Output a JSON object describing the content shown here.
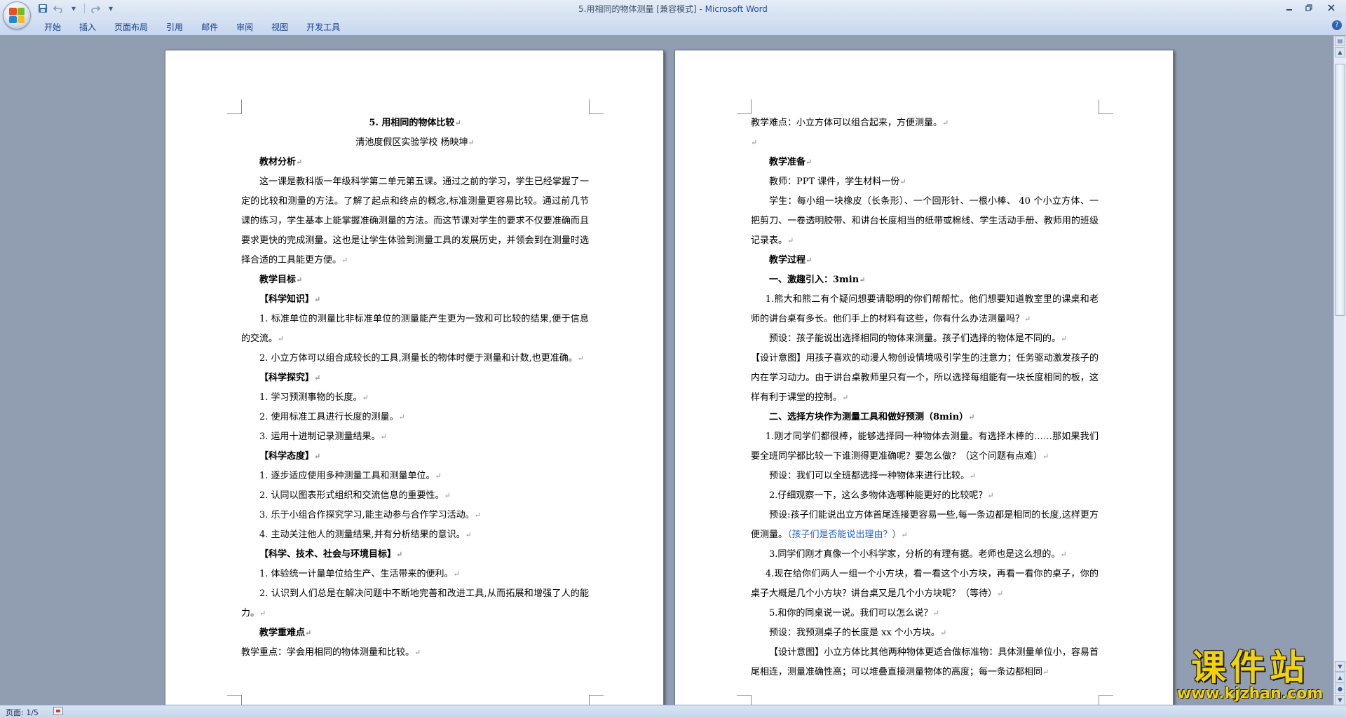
{
  "window": {
    "title": "5.用相同的物体测量 [兼容模式]",
    "app_name": "Microsoft Word",
    "title_sep": " - "
  },
  "qat": {
    "dropdown": "▾"
  },
  "ribbon": {
    "tabs": [
      "开始",
      "插入",
      "页面布局",
      "引用",
      "邮件",
      "审阅",
      "视图",
      "开发工具"
    ],
    "help": "?"
  },
  "page_left": {
    "paragraphs": [
      {
        "text": "5.  用相同的物体比较",
        "style": "center bold"
      },
      {
        "text": "清池度假区实验学校    杨映坤",
        "style": "center"
      },
      {
        "text": "教材分析",
        "style": "p-indent bold"
      },
      {
        "text": "这一课是教科版一年级科学第二单元第五课。通过之前的学习，学生已经掌握了一定的比较和测量的方法。了解了起点和终点的概念,标准测量更容易比较。通过前几节课的练习，学生基本上能掌握准确测量的方法。而这节课对学生的要求不仅要准确而且要求更快的完成测量。这也是让学生体验到测量工具的发展历史，并领会到在测量时选择合适的工具能更方便。",
        "style": "p-indent"
      },
      {
        "text": "教学目标",
        "style": "p-indent bold"
      },
      {
        "text": "【科学知识】",
        "style": "p-indent bold"
      },
      {
        "text": "1.  标准单位的测量比非标准单位的测量能产生更为一致和可比较的结果,便于信息的交流。",
        "style": "p-indent"
      },
      {
        "text": "2.  小立方体可以组合成较长的工具,测量长的物体时便于测量和计数,也更准确。",
        "style": "p-indent"
      },
      {
        "text": "【科学探究】",
        "style": "p-indent bold"
      },
      {
        "text": "1.  学习预测事物的长度。",
        "style": "p-indent"
      },
      {
        "text": "2.  使用标准工具进行长度的测量。",
        "style": "p-indent"
      },
      {
        "text": "3.  运用十进制记录测量结果。",
        "style": "p-indent"
      },
      {
        "text": "【科学态度】",
        "style": "p-indent bold"
      },
      {
        "text": "1.  逐步适应使用多种测量工具和测量单位。",
        "style": "p-indent"
      },
      {
        "text": "2.  认同以图表形式组织和交流信息的重要性。",
        "style": "p-indent"
      },
      {
        "text": "3.  乐于小组合作探究学习,能主动参与合作学习活动。",
        "style": "p-indent"
      },
      {
        "text": "4.  主动关注他人的测量结果,并有分析结果的意识。",
        "style": "p-indent"
      },
      {
        "text": "【科学、技术、社会与环境目标】",
        "style": "p-indent bold"
      },
      {
        "text": "1.  体验统一计量单位给生产、生活带来的便利。",
        "style": "p-indent"
      },
      {
        "text": "2.  认识到人们总是在解决问题中不断地完善和改进工具,从而拓展和增强了人的能力。",
        "style": "p-indent"
      },
      {
        "text": "教学重难点",
        "style": "p-indent bold"
      },
      {
        "text": "教学重点：学会用相同的物体测量和比较。",
        "style": ""
      }
    ]
  },
  "page_right": {
    "paragraphs": [
      {
        "text": "教学难点：小立方体可以组合起来，方便测量。",
        "style": ""
      },
      {
        "text": "",
        "style": ""
      },
      {
        "text": "教学准备",
        "style": "p-indent bold"
      },
      {
        "text": "教师：PPT 课件，学生材料一份",
        "style": "p-indent"
      },
      {
        "text": "学生：每小组一块橡皮（长条形）、一个回形针、一根小棒、 40 个小立方体、一把剪刀、一卷透明胶带、和讲台长度相当的纸带或棉线、学生活动手册、教师用的班级记录表。",
        "style": "p-indent"
      },
      {
        "text": "教学过程",
        "style": "p-indent bold"
      },
      {
        "text": "一、激趣引入：3min",
        "style": "p-indent bold"
      },
      {
        "text": "1.熊大和熊二有个疑问想要请聪明的你们帮帮忙。他们想要知道教室里的课桌和老师的讲台桌有多长。他们手上的材料有这些，你有什么办法测量吗？",
        "style": "p-indent1"
      },
      {
        "text": "预设：孩子能说出选择相同的物体来测量。孩子们选择的物体是不同的。",
        "style": "p-indent"
      },
      {
        "text": "【设计意图】用孩子喜欢的动漫人物创设情境吸引学生的注意力；任务驱动激发孩子的内在学习动力。由于讲台桌教师里只有一个，所以选择每组能有一块长度相同的板，这样有利于课堂的控制。",
        "style": ""
      },
      {
        "text": "二、选择方块作为测量工具和做好预测（8min）",
        "style": "p-indent bold"
      },
      {
        "text": "1.刚才同学们都很棒，能够选择同一种物体去测量。有选择木棒的……那如果我们要全班同学都比较一下谁测得更准确呢？要怎么做？（这个问题有点难）",
        "style": "p-indent1"
      },
      {
        "text": "预设：我们可以全班都选择一种物体来进行比较。",
        "style": "p-indent"
      },
      {
        "text": "2.仔细观察一下，这么多物体选哪种能更好的比较呢？",
        "style": "p-indent"
      },
      {
        "text": "预设:孩子们能说出立方体首尾连接更容易一些,每一条边都是相同的长度,这样更方便测量。",
        "style": "p-indent",
        "link": "（孩子们是否能说出理由？）"
      },
      {
        "text": "3.同学们刚才真像一个小科学家，分析的有理有据。老师也是这么想的。",
        "style": "p-indent"
      },
      {
        "text": "4.现在给你们两人一组一个小方块，看一看这个小方块，再看一看你的桌子，你的桌子大概是几个小方块？讲台桌又是几个小方块呢？（等待）",
        "style": "p-indent1"
      },
      {
        "text": "5.和你的同桌说一说。我们可以怎么说？",
        "style": "p-indent"
      },
      {
        "text": "预设：我预测桌子的长度是 xx 个小方块。",
        "style": "p-indent"
      },
      {
        "text": "【设计意图】小立方体比其他两种物体更适合做标准物：具体测量单位小，容易首尾相连，测量准确性高；可以堆叠直接测量物体的高度；每一条边都相同",
        "style": "p-indent"
      }
    ]
  },
  "status": {
    "page": "页面: 1/5"
  },
  "watermark": {
    "cn": "课件站",
    "url": "www.kjzhan.com"
  },
  "colors": {
    "ribbon_text": "#15428b",
    "doc_bg": "#919eb1",
    "watermark": "#f2d20c"
  }
}
